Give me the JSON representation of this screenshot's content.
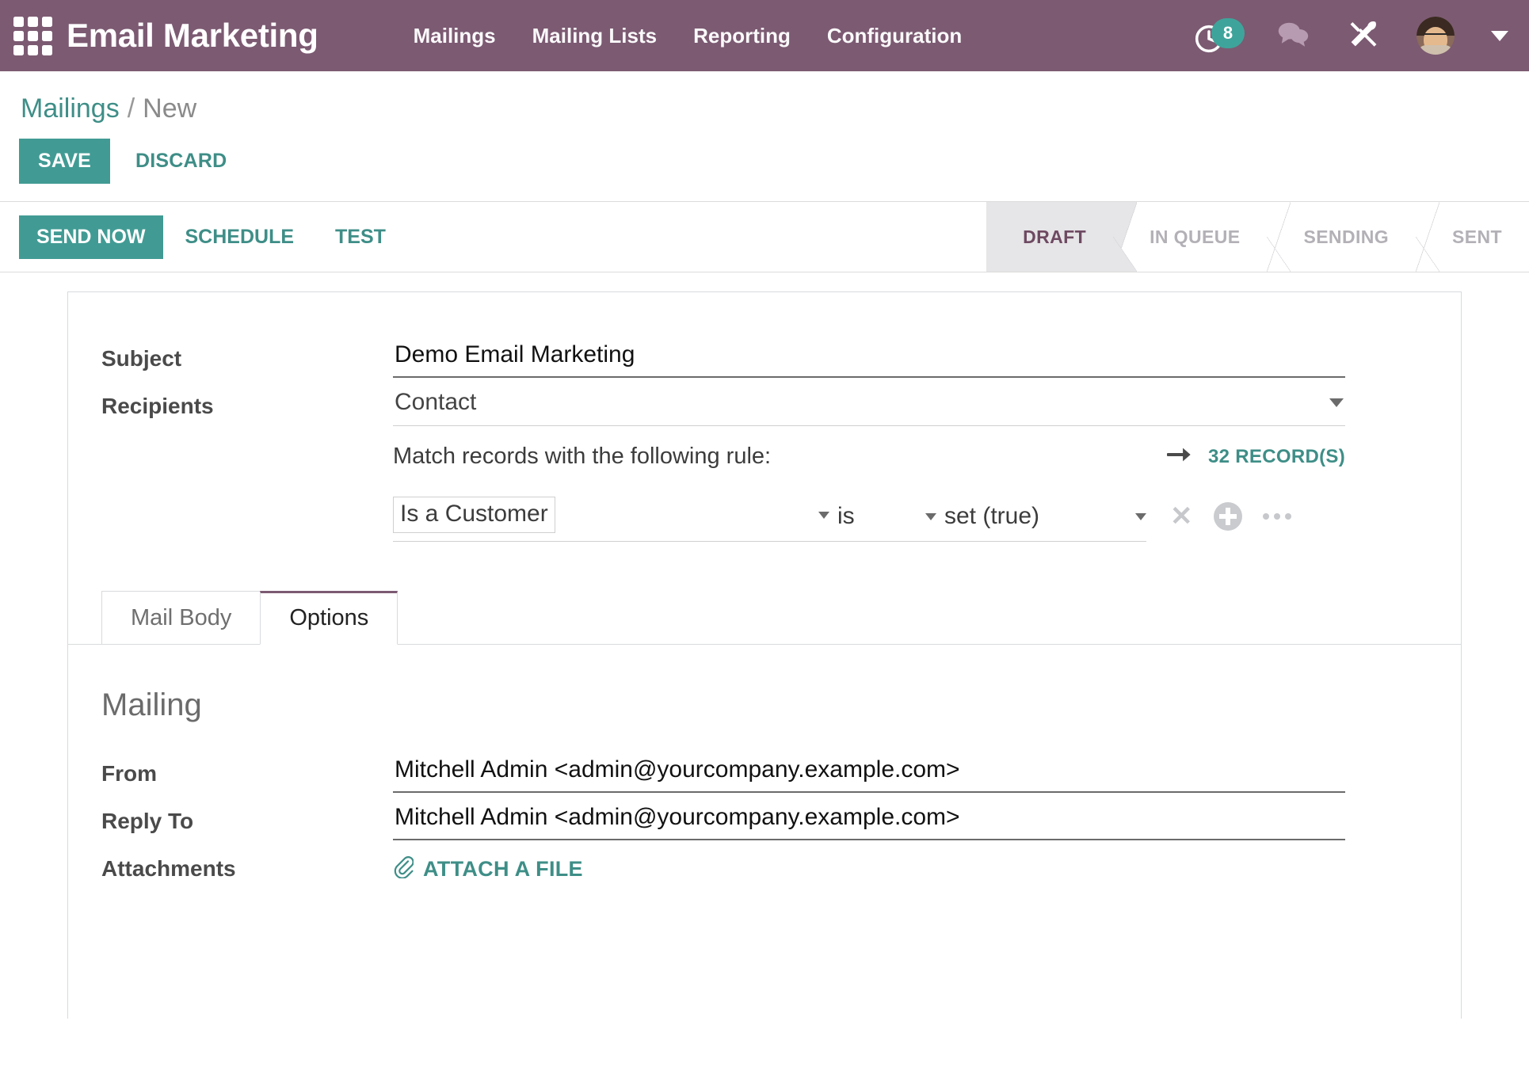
{
  "navbar": {
    "apps_icon": "apps-grid-icon",
    "brand": "Email Marketing",
    "links": [
      {
        "label": "Mailings"
      },
      {
        "label": "Mailing Lists"
      },
      {
        "label": "Reporting"
      },
      {
        "label": "Configuration"
      }
    ],
    "activity": {
      "icon": "clock-icon",
      "count": "8"
    },
    "messages_icon": "chat-bubbles-icon",
    "tools_icon": "wrench-screwdriver-icon",
    "avatar": "user-avatar",
    "user_caret": "chevron-down-icon",
    "bg_color": "#7C5A72"
  },
  "breadcrumb": {
    "root": "Mailings",
    "separator": "/",
    "current": "New"
  },
  "toolbar": {
    "save_label": "SAVE",
    "discard_label": "DISCARD",
    "accent_color": "#419B94"
  },
  "action_bar": {
    "send_now_label": "SEND NOW",
    "schedule_label": "SCHEDULE",
    "test_label": "TEST",
    "stages": [
      {
        "label": "DRAFT",
        "active": true
      },
      {
        "label": "IN QUEUE",
        "active": false
      },
      {
        "label": "SENDING",
        "active": false
      },
      {
        "label": "SENT",
        "active": false
      }
    ],
    "active_stage_color": "#6E4A62"
  },
  "form": {
    "subject": {
      "label": "Subject",
      "value": "Demo Email Marketing",
      "placeholder": "Subject"
    },
    "recipients": {
      "label": "Recipients",
      "value": "Contact",
      "caret": "chevron-down-icon"
    },
    "rule": {
      "heading": "Match records with the following rule:",
      "arrow_icon": "arrow-right-icon",
      "records_link": "32 RECORD(S)",
      "field": "Is a Customer",
      "operator": "is",
      "value": "set (true)",
      "remove_icon": "times-icon",
      "add_icon": "plus-circle-icon",
      "more_icon": "ellipsis-icon"
    }
  },
  "notebook": {
    "tabs": [
      {
        "label": "Mail Body",
        "active": false
      },
      {
        "label": "Options",
        "active": true
      }
    ]
  },
  "options_tab": {
    "section_title": "Mailing",
    "from": {
      "label": "From",
      "value": "Mitchell Admin <admin@yourcompany.example.com>"
    },
    "reply_to": {
      "label": "Reply To",
      "value": "Mitchell Admin <admin@yourcompany.example.com>"
    },
    "attachments": {
      "label": "Attachments",
      "button_label": "ATTACH A FILE",
      "icon": "paperclip-icon"
    }
  }
}
